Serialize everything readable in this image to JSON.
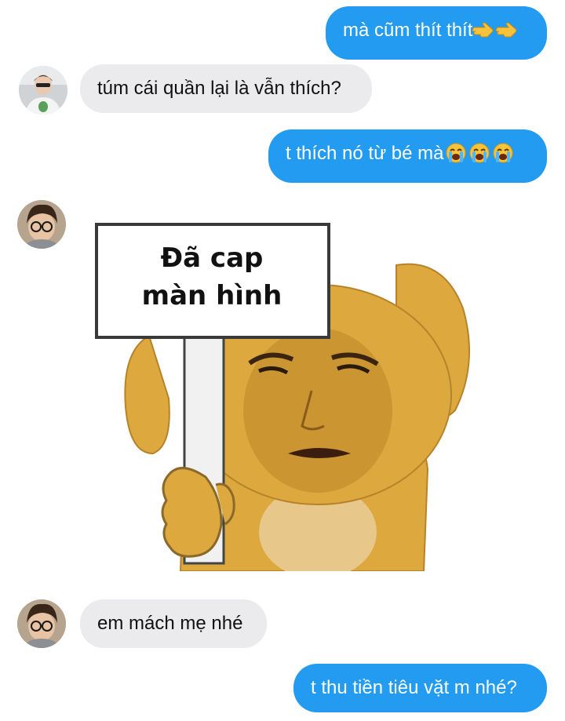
{
  "colors": {
    "outgoing_bubble": "#229bf0",
    "incoming_bubble": "#ebebed",
    "sticker_bear": "#dda93e"
  },
  "messages": [
    {
      "id": "m1",
      "direction": "outgoing",
      "text": "mà cũm thít thít",
      "emoji": [
        "point-right-emoji",
        "point-right-emoji"
      ]
    },
    {
      "id": "m2",
      "direction": "incoming",
      "text": "túm cái quần lại là vẫn thích?",
      "avatar": "avatar-1"
    },
    {
      "id": "m3",
      "direction": "outgoing",
      "text": "t thích nó từ bé mà",
      "emoji": [
        "loudly-crying-emoji",
        "loudly-crying-emoji",
        "loudly-crying-emoji"
      ]
    },
    {
      "id": "m4",
      "direction": "incoming",
      "type": "sticker",
      "sign_line1": "Đã cap",
      "sign_line2": "màn hình",
      "avatar": "avatar-2"
    },
    {
      "id": "m5",
      "direction": "incoming",
      "text": "em mách mẹ nhé",
      "avatar": "avatar-2"
    },
    {
      "id": "m6",
      "direction": "outgoing",
      "text": "t thu tiền tiêu vặt m nhé?"
    }
  ]
}
